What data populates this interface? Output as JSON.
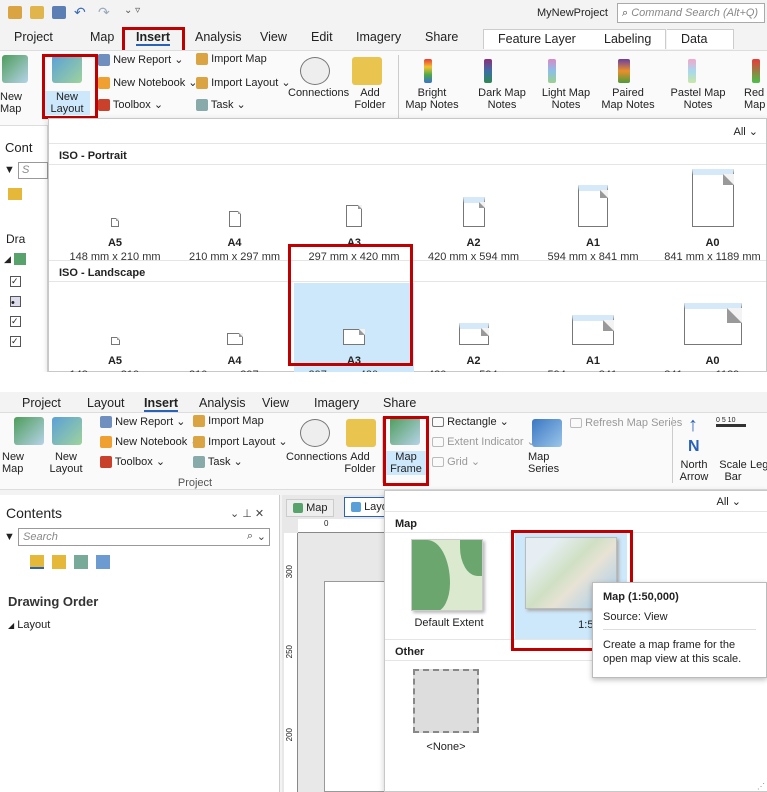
{
  "qat": {
    "project_name": "MyNewProject",
    "search_placeholder": "Command Search (Alt+Q)"
  },
  "top": {
    "tabs": [
      "Project",
      "Map",
      "Insert",
      "Analysis",
      "View",
      "Edit",
      "Imagery",
      "Share"
    ],
    "context_tabs": [
      "Feature Layer",
      "Labeling",
      "Data"
    ],
    "ribbon": {
      "new_map": "New\nMap",
      "new_layout": "New\nLayout",
      "new_report": "New Report",
      "new_notebook": "New Notebook",
      "toolbox": "Toolbox",
      "import_map": "Import Map",
      "import_layout": "Import Layout",
      "task": "Task",
      "connections": "Connections",
      "add_folder": "Add\nFolder",
      "styles": [
        "Bright\nMap Notes",
        "Dark Map\nNotes",
        "Light Map\nNotes",
        "Paired\nMap Notes",
        "Pastel Map\nNotes",
        "Red\nMap"
      ]
    },
    "contents_partial": {
      "title": "Cont",
      "search": "S",
      "draw": "Dra"
    },
    "dropdown": {
      "filter": "All",
      "portrait_header": "ISO - Portrait",
      "landscape_header": "ISO - Landscape",
      "sizes": [
        {
          "name": "A5",
          "dims": "148 mm x 210 mm"
        },
        {
          "name": "A4",
          "dims": "210 mm x 297 mm"
        },
        {
          "name": "A3",
          "dims": "297 mm x 420 mm"
        },
        {
          "name": "A2",
          "dims": "420 mm x 594 mm"
        },
        {
          "name": "A1",
          "dims": "594 mm x 841 mm"
        },
        {
          "name": "A0",
          "dims": "841 mm x 1189 mm"
        }
      ]
    }
  },
  "bottom": {
    "tabs": [
      "Project",
      "Layout",
      "Insert",
      "Analysis",
      "View",
      "Imagery",
      "Share"
    ],
    "ribbon": {
      "new_map": "New\nMap",
      "new_layout": "New\nLayout",
      "new_report": "New Report",
      "new_notebook": "New Notebook",
      "toolbox": "Toolbox",
      "import_map": "Import Map",
      "import_layout": "Import Layout",
      "task": "Task",
      "connections": "Connections",
      "add_folder": "Add\nFolder",
      "group_label": "Project",
      "map_frame": "Map\nFrame",
      "rectangle": "Rectangle",
      "extent_indicator": "Extent Indicator",
      "grid": "Grid",
      "map_series": "Map\nSeries",
      "refresh_map_series": "Refresh Map Series",
      "north_arrow": "North\nArrow",
      "scale_bar": "Scale\nBar",
      "legend_partial": "Leg",
      "scale_ticks": "0 5 10"
    },
    "contents": {
      "title": "Contents",
      "search_placeholder": "Search",
      "drawing_order": "Drawing Order",
      "layout_item": "Layout"
    },
    "view_tabs": [
      "Map",
      "Layo"
    ],
    "ruler_top": "0",
    "ruler_side": [
      "300",
      "250",
      "200"
    ],
    "dropdown": {
      "filter": "All",
      "map_header": "Map",
      "default_extent": "Default Extent",
      "scale_item": "1:50,000",
      "other_header": "Other",
      "none_item": "<None>"
    },
    "tooltip": {
      "title": "Map (1:50,000)",
      "source": "Source: View",
      "description": "Create a map frame for the open map view at this scale."
    }
  }
}
